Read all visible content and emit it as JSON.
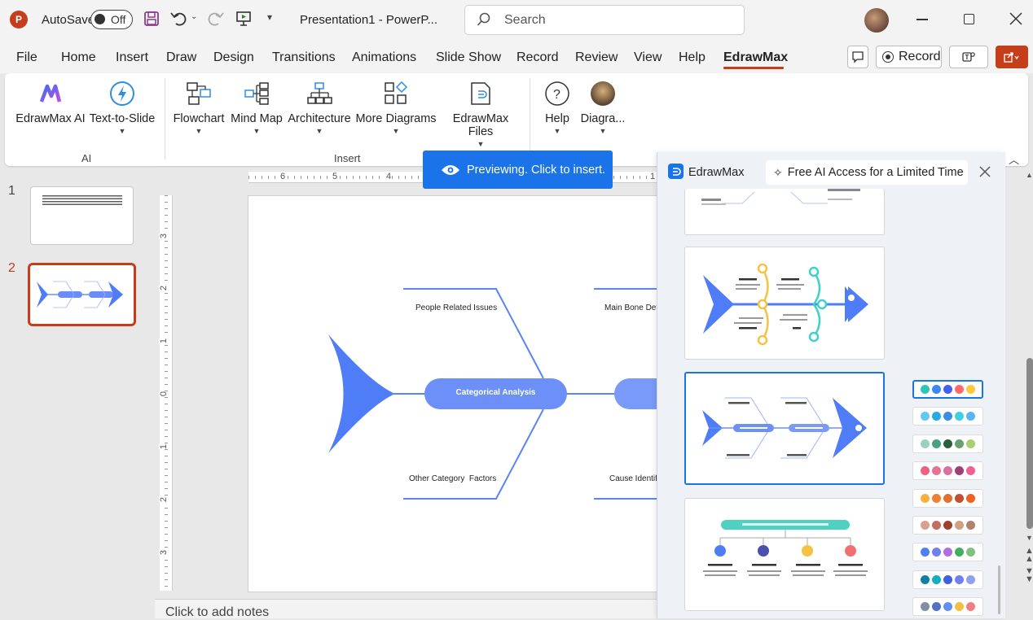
{
  "titlebar": {
    "autosave_label": "AutoSave",
    "autosave_state": "Off",
    "doc_title": "Presentation1 - PowerP...",
    "search_placeholder": "Search"
  },
  "tabs": [
    "File",
    "Home",
    "Insert",
    "Draw",
    "Design",
    "Transitions",
    "Animations",
    "Slide Show",
    "Record",
    "Review",
    "View",
    "Help",
    "EdrawMax"
  ],
  "active_tab": "EdrawMax",
  "record_button": "Record",
  "ribbon": {
    "ai": {
      "edrawmax_ai": "EdrawMax AI",
      "text_to_slide": "Text-to-Slide",
      "group_label": "AI"
    },
    "insert": {
      "flowchart": "Flowchart",
      "mind_map": "Mind Map",
      "architecture": "Architecture",
      "more_diagrams": "More Diagrams",
      "edrawmax_files": "EdrawMax Files",
      "group_label": "Insert"
    },
    "other": {
      "help": "Help",
      "diagrams": "Diagra..."
    }
  },
  "preview_toast": "Previewing. Click to insert.",
  "slides": [
    {
      "number": "1"
    },
    {
      "number": "2"
    }
  ],
  "slide_canvas": {
    "center_node": "Categorical  Analysis",
    "bone_top_left": "People Related Issues",
    "bone_top_right": "Main Bone Defi",
    "bone_bottom_left": "Other Category  Factors",
    "bone_bottom_right": "Cause Identifi"
  },
  "ruler": {
    "h_ticks": [
      "6",
      "5",
      "4",
      "1"
    ],
    "v_ticks": [
      "3",
      "2",
      "1",
      "0",
      "1",
      "2",
      "3"
    ]
  },
  "notes_placeholder": "Click to add notes",
  "panel": {
    "title": "EdrawMax",
    "promo": "Free AI Access for a Limited Time",
    "palettes": [
      [
        "#2ec4b6",
        "#3a86ff",
        "#4361ee",
        "#ff6b6b",
        "#ffc93c"
      ],
      [
        "#64c8f0",
        "#28a8e8",
        "#3b8fe0",
        "#3fd0e0",
        "#5ab4f0"
      ],
      [
        "#9ad0c0",
        "#4aa080",
        "#2a6040",
        "#6aa070",
        "#a8d070"
      ],
      [
        "#f06080",
        "#e87090",
        "#d870a0",
        "#a04070",
        "#f06090"
      ],
      [
        "#f8b040",
        "#f08030",
        "#e07030",
        "#c05030",
        "#f06020"
      ],
      [
        "#d8a090",
        "#c07060",
        "#a04030",
        "#d0a080",
        "#b08070"
      ],
      [
        "#5080f0",
        "#7080f0",
        "#b070e0",
        "#40b060",
        "#80c080"
      ],
      [
        "#1080a0",
        "#10b0c0",
        "#4060e0",
        "#7080f0",
        "#90a0f0"
      ],
      [
        "#8090a0",
        "#5070c0",
        "#6090f0",
        "#f0c040",
        "#f08080"
      ]
    ]
  },
  "colors": {
    "accent": "#2f8de4",
    "edraw_underline": "#c43e1c",
    "fish_blue": "#4f7cf7"
  }
}
